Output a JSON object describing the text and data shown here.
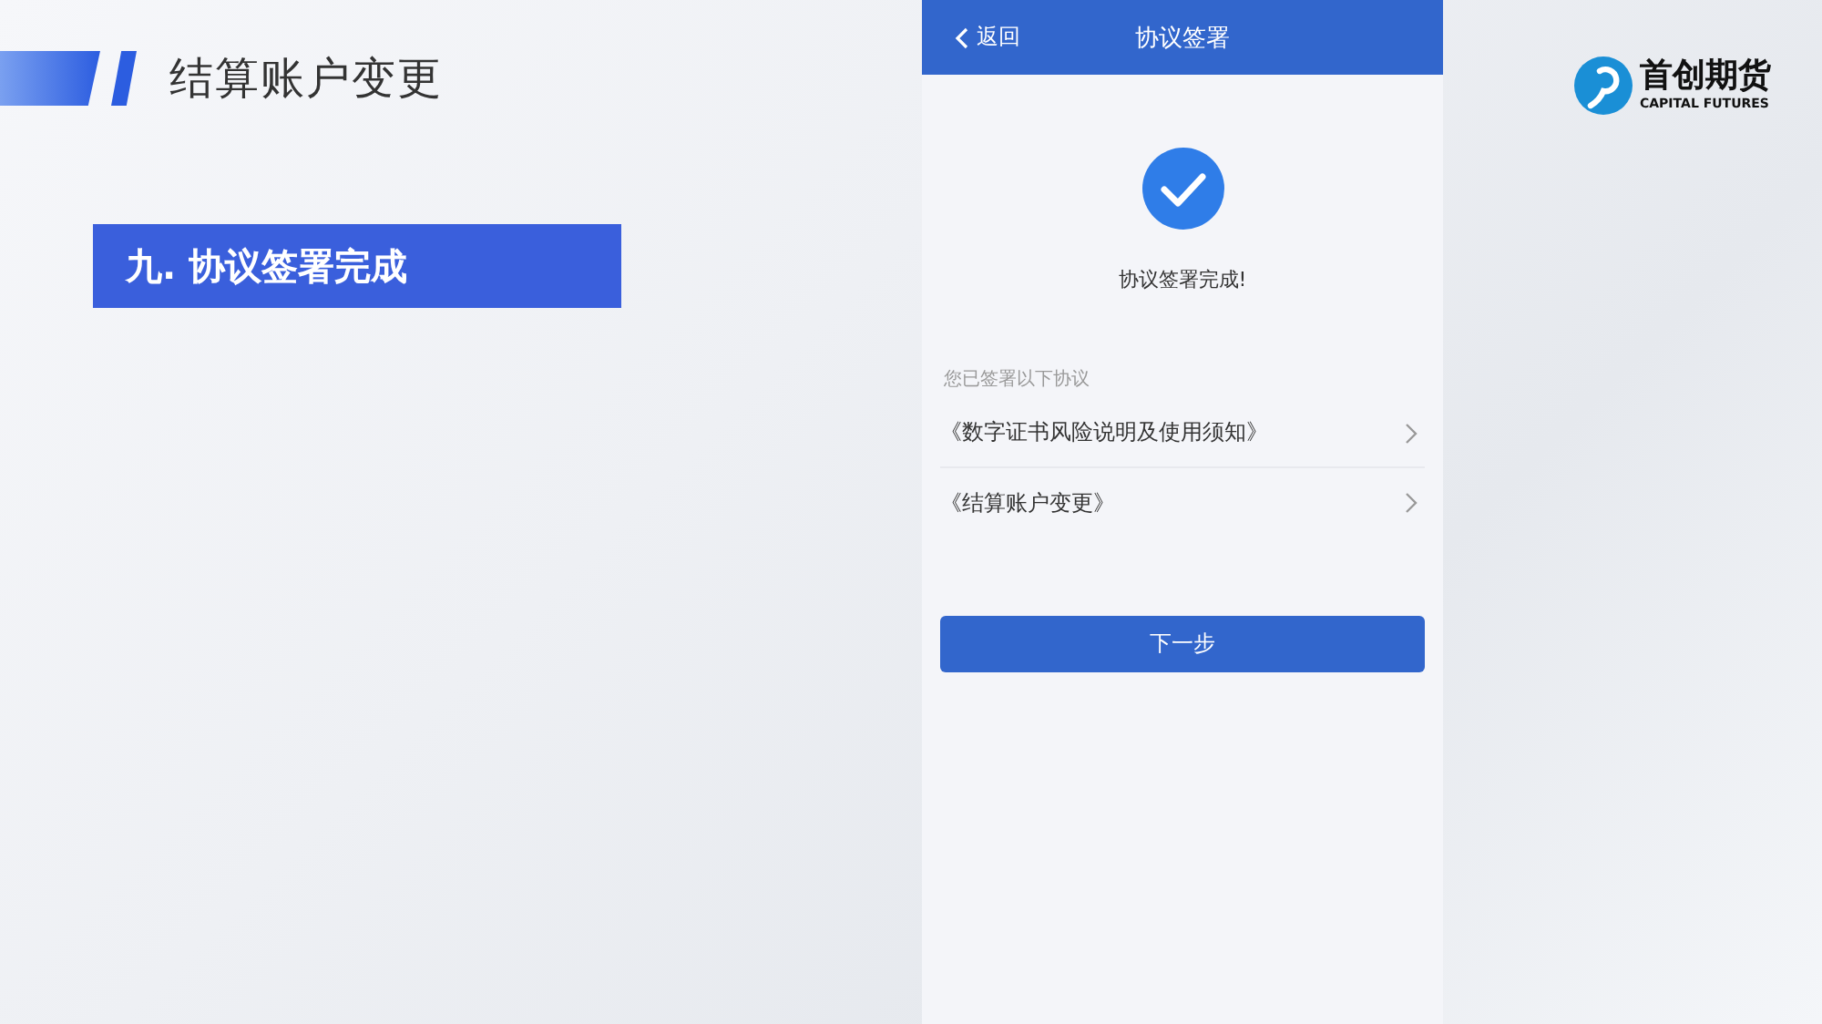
{
  "slide": {
    "title": "结算账户变更",
    "section": "九. 协议签署完成"
  },
  "phone": {
    "nav": {
      "back": "返回",
      "title": "协议签署"
    },
    "status": "协议签署完成!",
    "list_heading": "您已签署以下协议",
    "agreements": [
      {
        "label": "《数字证书风险说明及使用须知》"
      },
      {
        "label": "《结算账户变更》"
      }
    ],
    "next_button": "下一步"
  },
  "logo": {
    "name": "首创期货",
    "subtitle": "CAPITAL FUTURES"
  }
}
